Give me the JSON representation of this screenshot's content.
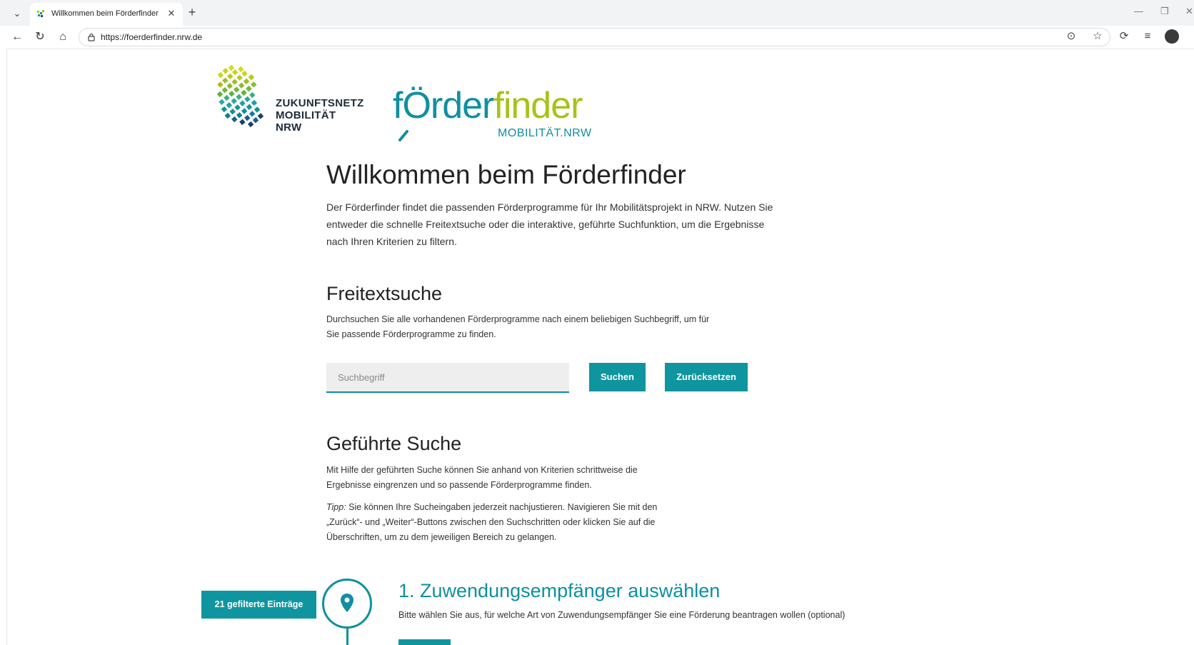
{
  "browser": {
    "tab_title": "Willkommen beim Förderfinder",
    "url": "https://foerderfinder.nrw.de"
  },
  "logos": {
    "zukunftsnetz_lines": [
      "ZUKUNFTSNETZ",
      "MOBILITÄT",
      "NRW"
    ],
    "foerderfinder_part1": "fÖrder",
    "foerderfinder_part2": "finder",
    "foerderfinder_sub": "MOBILITÄT.NRW"
  },
  "page": {
    "title": "Willkommen beim Förderfinder",
    "intro": "Der Förderfinder findet die passenden Förderprogramme für Ihr Mobilitätsprojekt in NRW. Nutzen Sie entweder die schnelle Freitextsuche oder die interaktive, geführte Suchfunktion, um die Ergebnisse nach Ihren Kriterien zu filtern."
  },
  "freitext": {
    "heading": "Freitextsuche",
    "description": "Durchsuchen Sie alle vorhandenen Förderprogramme nach einem beliebigen Suchbegriff, um für Sie passende Förderprogramme zu finden.",
    "placeholder": "Suchbegriff",
    "search_label": "Suchen",
    "reset_label": "Zurücksetzen"
  },
  "gefuehrt": {
    "heading": "Geführte Suche",
    "description": "Mit Hilfe der geführten Suche können Sie anhand von Kriterien schrittweise die Ergebnisse eingrenzen und so passende Förderprogramme finden.",
    "tip_label": "Tipp:",
    "tip_text": " Sie können Ihre Sucheingaben jederzeit nachjustieren. Navigieren Sie mit den „Zurück“- und „Weiter“-Buttons zwischen den Suchschritten oder klicken Sie auf die Überschriften, um zu dem jeweiligen Bereich zu gelangen."
  },
  "step1": {
    "counter": "21 gefilterte Einträge",
    "title": "1. Zuwendungsempfänger auswählen",
    "description": "Bitte wählen Sie aus, für welche Art von Zuwendungsempfänger Sie eine Förderung beantragen wollen (optional)",
    "icon": "location-pin-icon"
  },
  "colors": {
    "teal": "#0f95a0",
    "lime": "#a8c21a"
  }
}
